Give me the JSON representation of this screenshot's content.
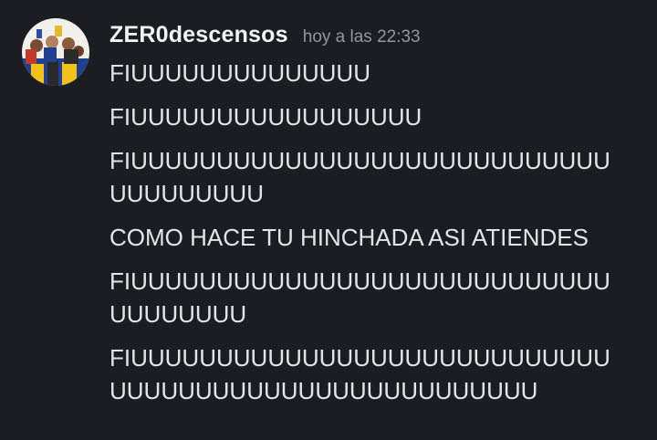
{
  "message": {
    "username": "ZER0descensos",
    "timestamp": "hoy a las 22:33",
    "lines": [
      "FIUUUUUUUUUUUUUU",
      "FIUUUUUUUUUUUUUUUUU",
      "FIUUUUUUUUUUUUUUUUUUUUUUUUUUUU\nUUUUUUUUU",
      "COMO HACE TU HINCHADA ASI ATIENDES",
      "FIUUUUUUUUUUUUUUUUUUUUUUUUUUUU\nUUUUUUUU",
      "FIUUUUUUUUUUUUUUUUUUUUUUUUUUUU\nUUUUUUUUUUUUUUUUUUUUUUUUU"
    ]
  }
}
